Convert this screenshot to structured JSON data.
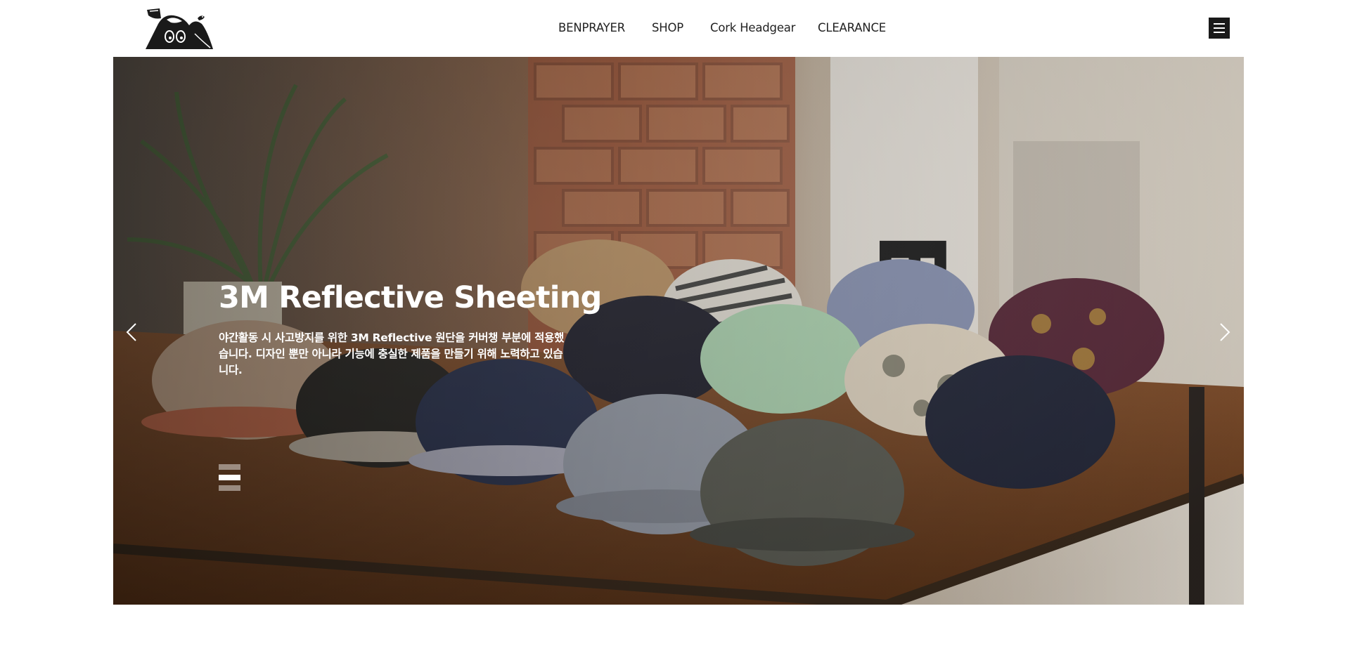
{
  "header": {
    "logo_icon": "cat-face-logo-icon",
    "nav": [
      {
        "label": "BENPRAYER"
      },
      {
        "label": "SHOP"
      },
      {
        "label": "Cork Headgear"
      },
      {
        "label": "CLEARANCE"
      }
    ],
    "menu_icon": "hamburger-menu-icon"
  },
  "hero": {
    "slide": {
      "title": "3M Reflective Sheeting",
      "description": "야간활동 시 사고방지를 위한 3M Reflective 원단을 커버챙 부분에 적용했습니다. 디자인 뿐만 아니라 기능에 충실한 제품을 만들기 위해 노력하고 있습니다."
    },
    "prev_icon": "chevron-left-icon",
    "next_icon": "chevron-right-icon",
    "pager": {
      "count": 3,
      "active": 2
    },
    "colors": {
      "text": "#ffffff",
      "wood": "#7a4a28",
      "brick": "#a8583a"
    }
  }
}
